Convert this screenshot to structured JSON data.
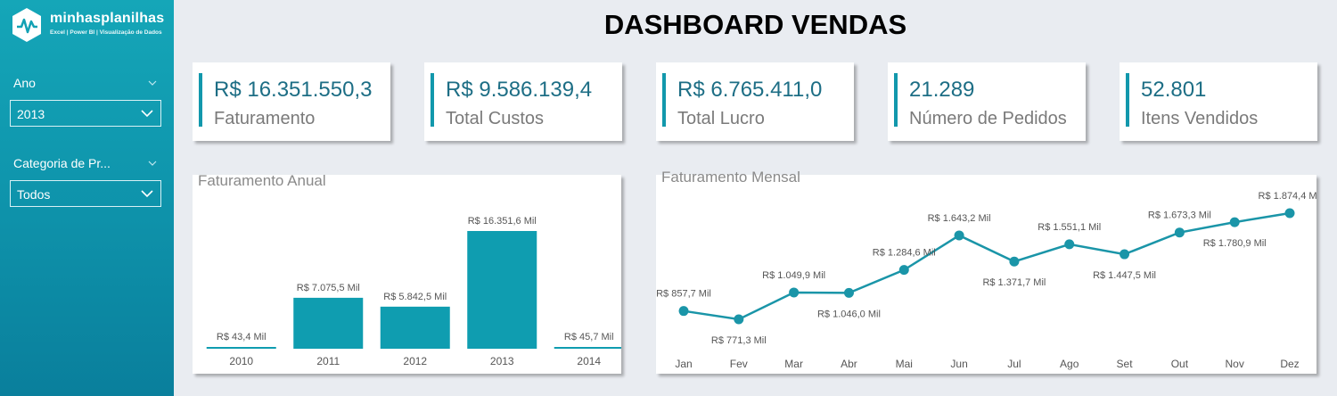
{
  "logo": {
    "name": "minhasplanilhas",
    "tagline": "Excel | Power BI | Visualização de Dados"
  },
  "filters": {
    "ano": {
      "label": "Ano",
      "selected": "2013"
    },
    "categoria": {
      "label": "Categoria de Pr...",
      "selected": "Todos"
    }
  },
  "title": "DASHBOARD VENDAS",
  "kpis": [
    {
      "value": "R$ 16.351.550,3",
      "label": "Faturamento"
    },
    {
      "value": "R$ 9.586.139,4",
      "label": "Total Custos"
    },
    {
      "value": "R$ 6.765.411,0",
      "label": "Total Lucro"
    },
    {
      "value": "21.289",
      "label": "Número de Pedidos"
    },
    {
      "value": "52.801",
      "label": "Itens Vendidos"
    }
  ],
  "colors": {
    "accent": "#0f9db0",
    "sidebar": "#1298ac",
    "kpi_value": "#1d6e85"
  },
  "chart_data": [
    {
      "type": "bar",
      "title": "Faturamento Anual",
      "categories": [
        "2010",
        "2011",
        "2012",
        "2013",
        "2014"
      ],
      "values": [
        43.4,
        7075.5,
        5842.5,
        16351.6,
        45.7
      ],
      "data_labels": [
        "R$ 43,4 Mil",
        "R$ 7.075,5 Mil",
        "R$ 5.842,5 Mil",
        "R$ 16.351,6 Mil",
        "R$ 45,7 Mil"
      ],
      "unit": "R$ Mil",
      "ylim": [
        0,
        16351.6
      ],
      "color": "#0f9db0"
    },
    {
      "type": "line",
      "title": "Faturamento Mensal",
      "categories": [
        "Jan",
        "Fev",
        "Mar",
        "Abr",
        "Mai",
        "Jun",
        "Jul",
        "Ago",
        "Set",
        "Out",
        "Nov",
        "Dez"
      ],
      "values": [
        857.7,
        771.3,
        1049.9,
        1046.0,
        1284.6,
        1643.2,
        1371.7,
        1551.1,
        1447.5,
        1673.3,
        1780.9,
        1874.4
      ],
      "data_labels": [
        "R$ 857,7 Mil",
        "R$ 771,3 Mil",
        "R$ 1.049,9 Mil",
        "R$ 1.046,0 Mil",
        "R$ 1.284,6 Mil",
        "R$ 1.643,2 Mil",
        "R$ 1.371,7 Mil",
        "R$ 1.551,1 Mil",
        "R$ 1.447,5 Mil",
        "R$ 1.673,3 Mil",
        "R$ 1.780,9 Mil",
        "R$ 1.874,4 Mil"
      ],
      "unit": "R$ Mil",
      "color": "#1a95a8"
    }
  ]
}
